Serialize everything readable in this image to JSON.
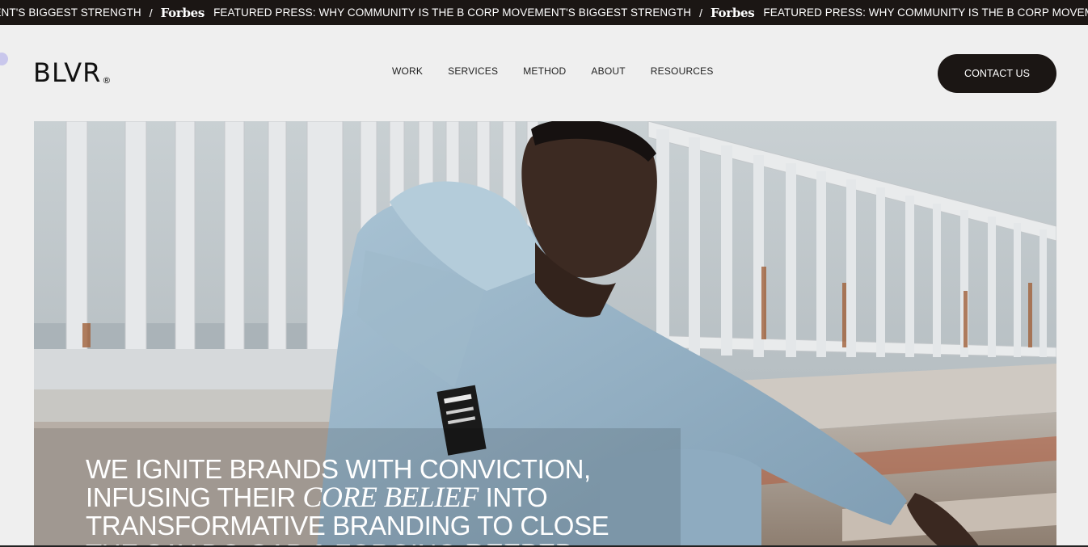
{
  "ticker": {
    "segments": [
      {
        "text": "EMENT'S BIGGEST STRENGTH"
      },
      {
        "sep": "/"
      },
      {
        "logo": "Forbes"
      },
      {
        "text": "FEATURED PRESS: WHY COMMUNITY IS THE B CORP MOVEMENT'S BIGGEST STRENGTH"
      },
      {
        "sep": "/"
      },
      {
        "logo": "Forbes"
      },
      {
        "text": "FEATURED PRESS: WHY COMMUNITY IS THE B CORP MOVEMENT'S BIGGEST STRENGTH"
      }
    ]
  },
  "header": {
    "logo_text": "BLVR",
    "logo_mark": "®",
    "nav": [
      "WORK",
      "SERVICES",
      "METHOD",
      "ABOUT",
      "RESOURCES"
    ],
    "contact_label": "CONTACT US"
  },
  "hero": {
    "image_description_icon": "hero-photo",
    "headline": {
      "line1": "WE IGNITE BRANDS WITH CONVICTION,",
      "line2_a": "INFUSING THEIR ",
      "line2_em": "CORE BELIEF",
      "line2_b": " INTO",
      "line3": "TRANSFORMATIVE BRANDING TO CLOSE",
      "line4_a": "THE SAY-DO GAP & FORGING ",
      "line4_em": "DEEPER"
    }
  },
  "colors": {
    "dark": "#1b1614",
    "background": "#efefef",
    "accent_dot": "#c9c7ec"
  }
}
